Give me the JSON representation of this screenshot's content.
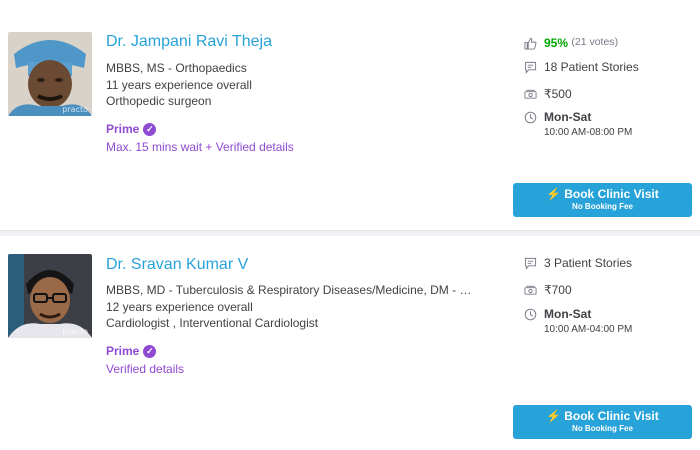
{
  "doctors": [
    {
      "name": "Dr. Jampani Ravi Theja",
      "qualification": "MBBS, MS - Orthopaedics",
      "experience": "11 years experience overall",
      "specialty": "Orthopedic surgeon",
      "prime_label": "Prime",
      "prime_detail": "Max. 15 mins wait + Verified details",
      "photo_watermark": "practo",
      "rating_percent": "95%",
      "rating_votes": "(21 votes)",
      "patient_stories": "18 Patient Stories",
      "fee": "₹500",
      "days": "Mon-Sat",
      "hours": "10:00 AM-08:00 PM",
      "book_label": "Book Clinic Visit",
      "book_sub": "No Booking Fee"
    },
    {
      "name": "Dr. Sravan Kumar V",
      "qualification": "MBBS, MD - Tuberculosis & Respiratory Diseases/Medicine, DM - Car...",
      "experience": "12 years experience overall",
      "specialty": "Cardiologist , Interventional Cardiologist",
      "prime_label": "Prime",
      "prime_detail": "Verified details",
      "photo_watermark": "practo",
      "patient_stories": "3 Patient Stories",
      "fee": "₹700",
      "days": "Mon-Sat",
      "hours": "10:00 AM-04:00 PM",
      "book_label": "Book Clinic Visit",
      "book_sub": "No Booking Fee"
    }
  ],
  "icons": {
    "thumbs_up": "thumbs-up-icon",
    "stories": "chat-bubble-icon",
    "fee": "money-icon",
    "clock": "clock-icon",
    "bolt": "lightning-icon",
    "prime_check": "check-badge-icon"
  },
  "colors": {
    "name_link": "#28a3da",
    "prime": "#8f4ad2",
    "rating": "#01a400",
    "button": "#28a3da"
  }
}
